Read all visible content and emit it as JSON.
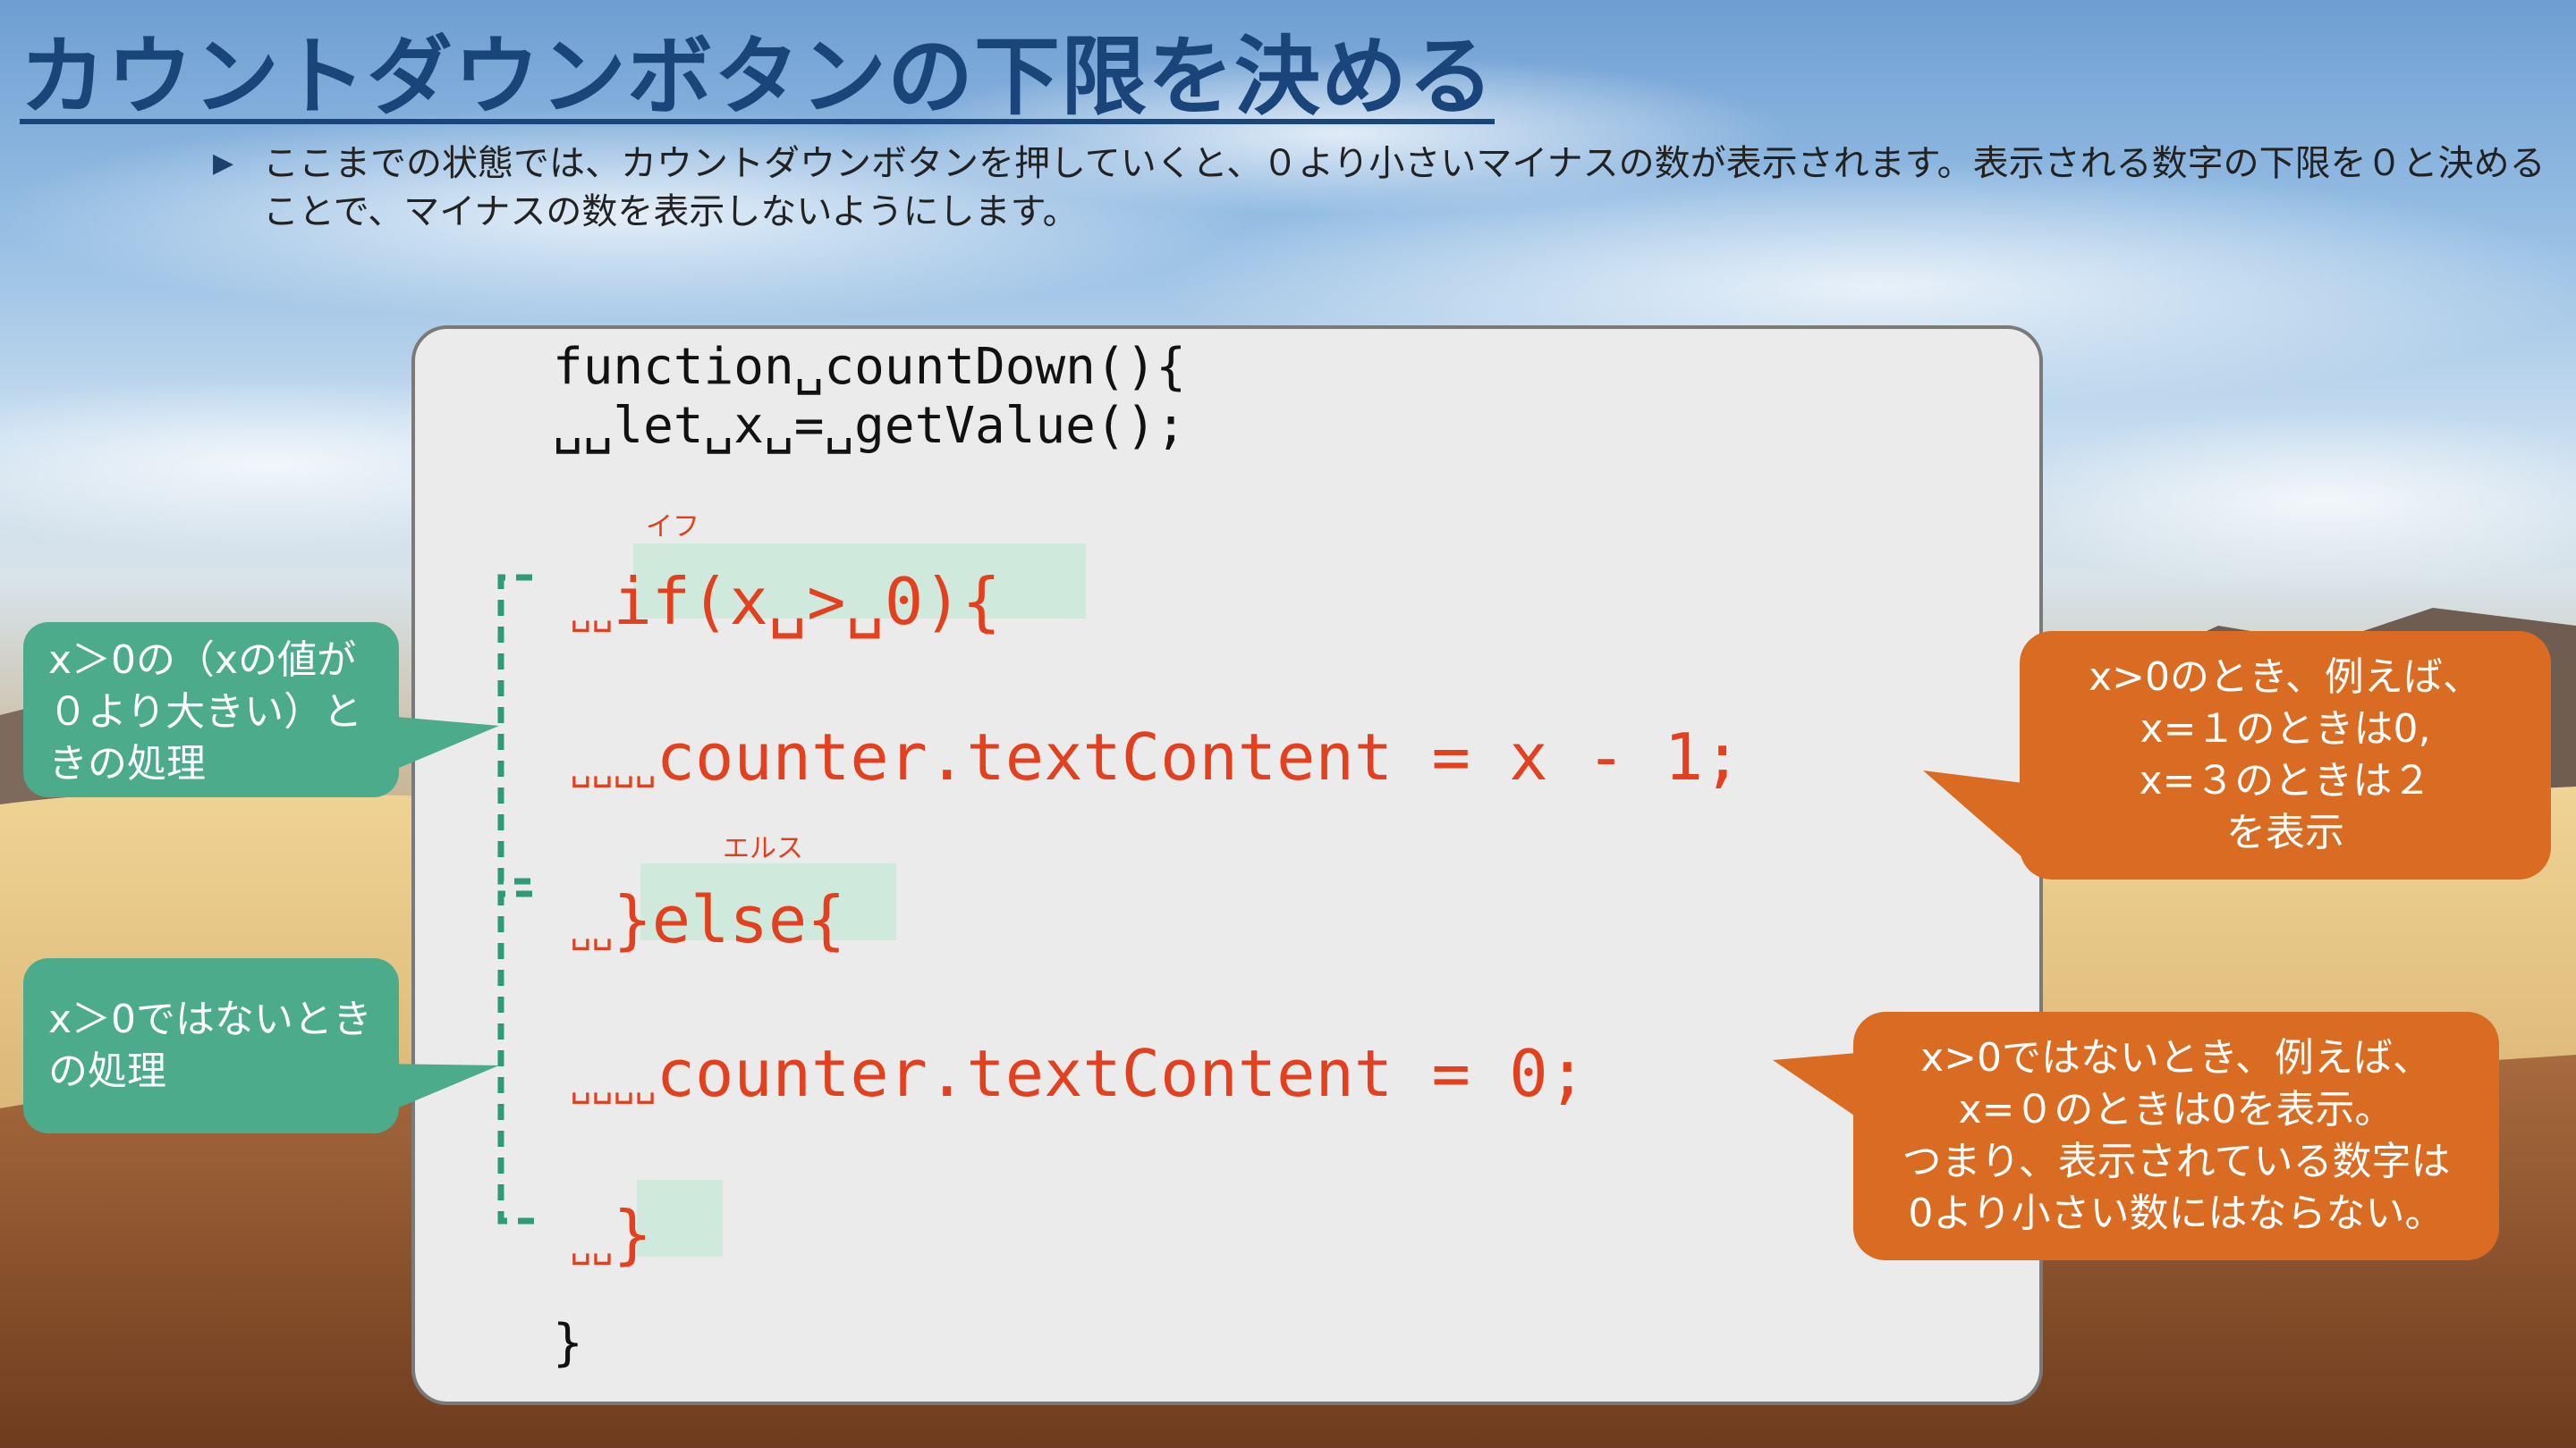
{
  "slide": {
    "title": "カウントダウンボタンの下限を決める",
    "intro": "ここまでの状態では、カウントダウンボタンを押していくと、０より小さいマイナスの数が表示されます。表示される数字の下限を０と決めることで、マイナスの数を表示しないようにします。"
  },
  "code": {
    "line1": "function␣countDown(){",
    "line2": "␣␣let␣x␣=␣getValue();",
    "if_indent": "␣␣",
    "if_text": "if(x␣>␣0){",
    "if_ruby": "イフ",
    "then_indent": "␣␣␣␣",
    "then_text": "counter.textContent = x - 1;",
    "else_indent": "␣␣",
    "else_text": "}else{",
    "else_ruby": "エルス",
    "else_body_indent": "␣␣␣␣",
    "else_body_text": "counter.textContent = 0;",
    "close_indent": "␣␣",
    "close_text": "}",
    "fn_close": "}"
  },
  "callouts": {
    "left_if": "x＞0の（xの値が０より大きい）ときの処理",
    "left_else": "x＞0ではないときの処理",
    "right_if": "x>0のとき、例えば、\nx=１のときは0,\nx=３のときは２\nを表示",
    "right_else": "x>0ではないとき、例えば、\nx=０のときは0を表示。\nつまり、表示されている数字は\n0より小さい数にはならない。"
  },
  "colors": {
    "title": "#19457a",
    "code_highlight": "#e2401e",
    "teal": "#4cab8a",
    "orange": "#d96c22",
    "bracket": "#2f9a78"
  },
  "icons": {
    "bullet": "triangle-right"
  }
}
